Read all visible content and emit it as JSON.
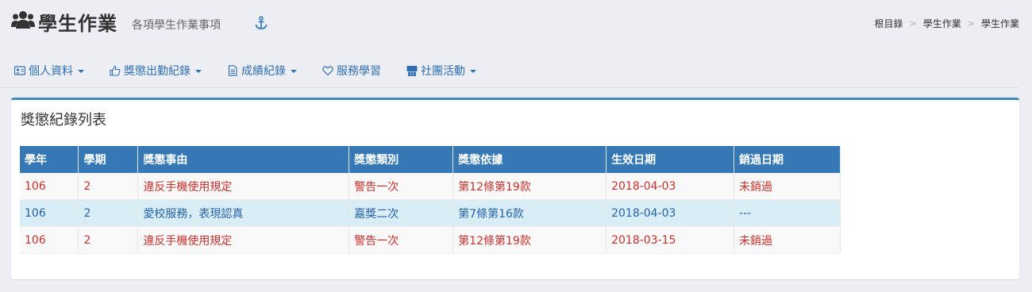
{
  "header": {
    "title": "學生作業",
    "subtitle": "各項學生作業事項",
    "breadcrumb": [
      "根目錄",
      "學生作業",
      "學生作業"
    ]
  },
  "nav": [
    {
      "label": "個人資料",
      "icon": "id-card-icon",
      "dropdown": true
    },
    {
      "label": "獎懲出勤紀錄",
      "icon": "thumbs-up-icon",
      "dropdown": true
    },
    {
      "label": "成績紀錄",
      "icon": "document-icon",
      "dropdown": true
    },
    {
      "label": "服務學習",
      "icon": "heart-icon",
      "dropdown": false
    },
    {
      "label": "社團活動",
      "icon": "group-icon",
      "dropdown": true
    }
  ],
  "panel": {
    "title": "獎懲紀錄列表"
  },
  "table": {
    "headers": [
      "學年",
      "學期",
      "獎懲事由",
      "獎懲類別",
      "獎懲依據",
      "生效日期",
      "銷過日期"
    ],
    "rows": [
      [
        "106",
        "2",
        "違反手機使用規定",
        "警告一次",
        "第12條第19款",
        "2018-04-03",
        "未銷過"
      ],
      [
        "106",
        "2",
        "愛校服務，表現認真",
        "嘉獎二次",
        "第7條第16款",
        "2018-04-03",
        "---"
      ],
      [
        "106",
        "2",
        "違反手機使用規定",
        "警告一次",
        "第12條第19款",
        "2018-03-15",
        "未銷過"
      ]
    ]
  },
  "colors": {
    "accent": "#3578b5",
    "warning_text": "#c9302c",
    "merit_text": "#2563a8",
    "merit_bg": "#d9edf7"
  }
}
